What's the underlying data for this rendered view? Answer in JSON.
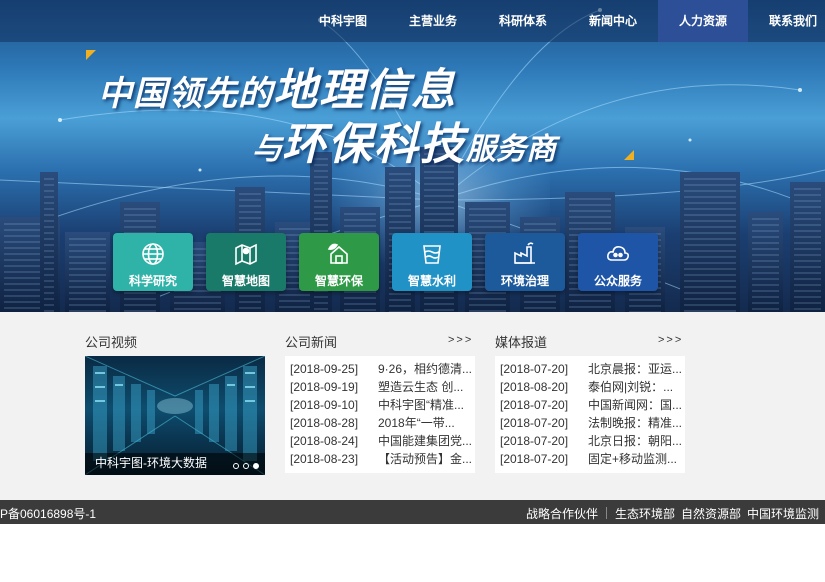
{
  "nav": {
    "items": [
      "中科宇图",
      "主营业务",
      "科研体系",
      "新闻中心",
      "人力资源",
      "联系我们"
    ],
    "active_index": 4
  },
  "banner": {
    "line1_small": "中国领先的",
    "line1_big": "地理信息",
    "line2_small1": "与",
    "line2_big": "环保科技",
    "line2_small2": "服务商"
  },
  "tiles": [
    {
      "label": "科学研究",
      "icon": "globe-icon",
      "color": "#2fb3a8"
    },
    {
      "label": "智慧地图",
      "icon": "map-pin-icon",
      "color": "#1a7a6a"
    },
    {
      "label": "智慧环保",
      "icon": "eco-house-icon",
      "color": "#2e9a47"
    },
    {
      "label": "智慧水利",
      "icon": "water-tank-icon",
      "color": "#2192c6"
    },
    {
      "label": "环境治理",
      "icon": "factory-icon",
      "color": "#1d5a9c"
    },
    {
      "label": "公众服务",
      "icon": "cloud-people-icon",
      "color": "#1f55a6"
    }
  ],
  "video": {
    "title": "公司视频",
    "caption": "中科宇图-环境大数据",
    "slide_count": 3,
    "active_slide": 2
  },
  "news": {
    "title": "公司新闻",
    "more": ">>>",
    "items": [
      {
        "date": "[2018-09-25]",
        "text": "9·26，相约德清..."
      },
      {
        "date": "[2018-09-19]",
        "text": "塑造云生态 创..."
      },
      {
        "date": "[2018-09-10]",
        "text": "中科宇图“精准..."
      },
      {
        "date": "[2018-08-28]",
        "text": "2018年“一带..."
      },
      {
        "date": "[2018-08-24]",
        "text": "中国能建集团党..."
      },
      {
        "date": "[2018-08-23]",
        "text": "【活动预告】金..."
      }
    ]
  },
  "media": {
    "title": "媒体报道",
    "more": ">>>",
    "items": [
      {
        "date": "[2018-07-20]",
        "text": "北京晨报：亚运..."
      },
      {
        "date": "[2018-08-20]",
        "text": "泰伯网|刘锐：..."
      },
      {
        "date": "[2018-07-20]",
        "text": "中国新闻网：国..."
      },
      {
        "date": "[2018-07-20]",
        "text": "法制晚报：精准..."
      },
      {
        "date": "[2018-07-20]",
        "text": "北京日报：朝阳..."
      },
      {
        "date": "[2018-07-20]",
        "text": "固定+移动监测..."
      }
    ]
  },
  "footer": {
    "icp": "P备06016898号-1",
    "partner_label": "战略合作伙伴",
    "partners": [
      "生态环境部",
      "自然资源部",
      "中国环境监测"
    ]
  }
}
